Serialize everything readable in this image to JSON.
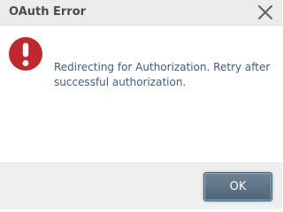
{
  "dialog": {
    "title": "OAuth Error",
    "message": "Redirecting for Authorization. Retry after successful authorization.",
    "ok_label": "OK"
  },
  "icons": {
    "close": "close-icon",
    "error": "error-icon"
  },
  "colors": {
    "error_red": "#c0282e",
    "message_text": "#3e5c7e",
    "button_bg": "#5a6f83"
  }
}
